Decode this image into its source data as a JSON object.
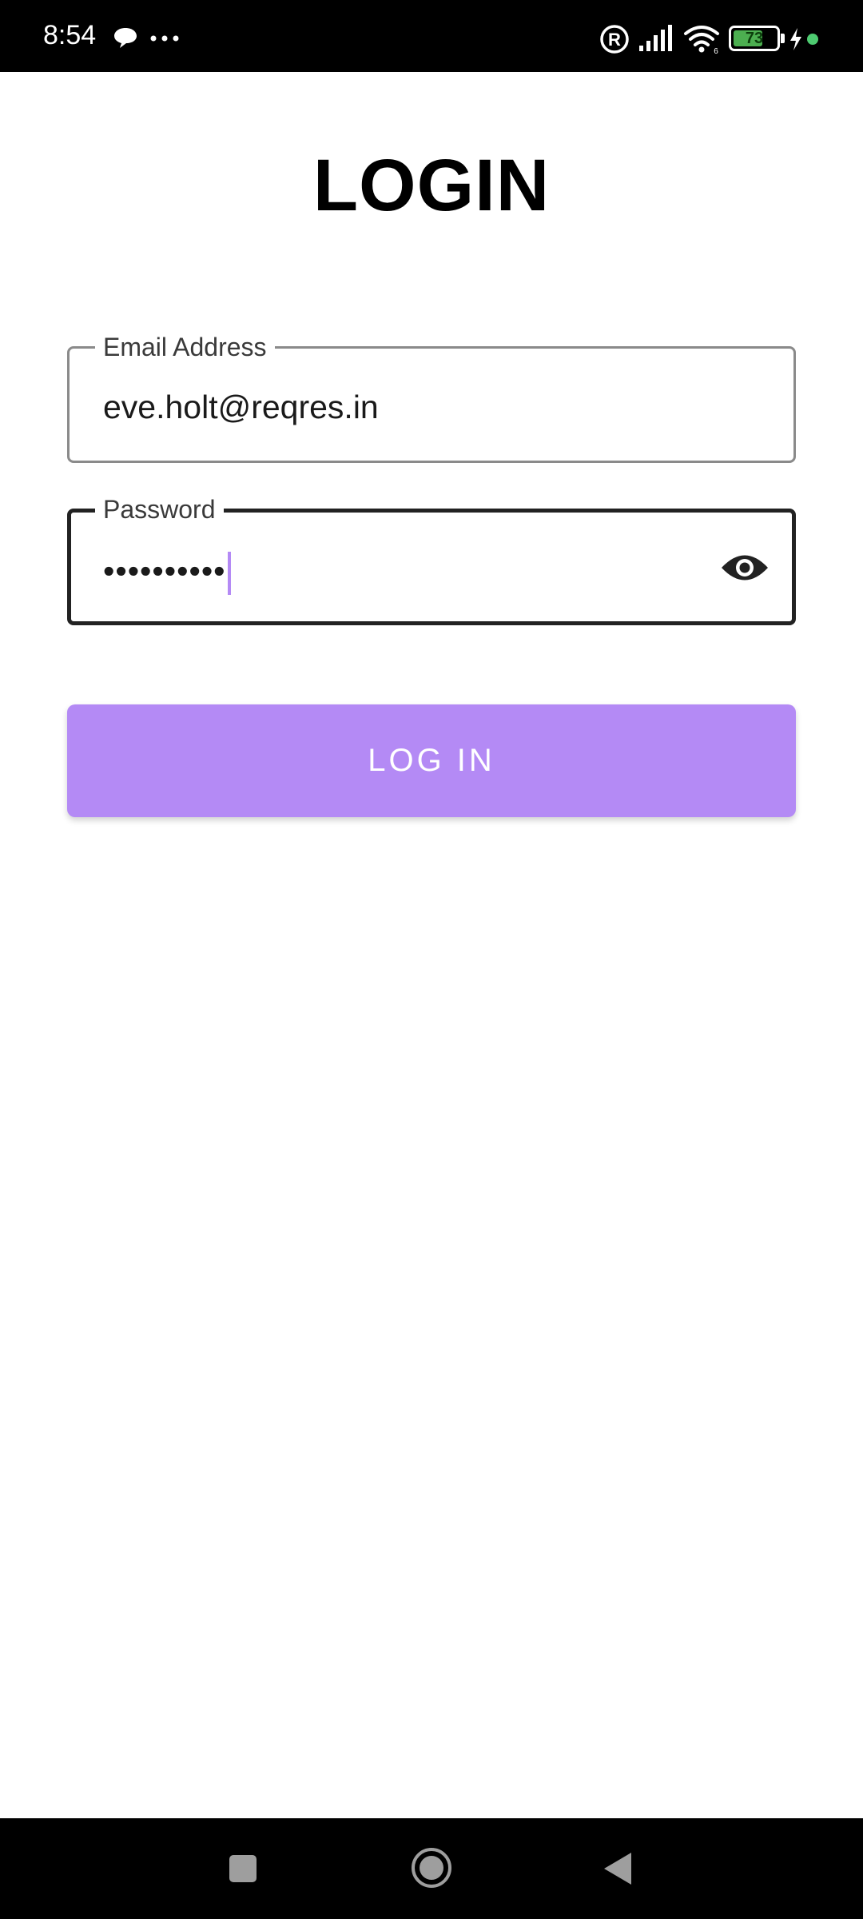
{
  "status_bar": {
    "time": "8:54",
    "battery_level": "73",
    "icons": [
      "message-icon",
      "more-dots-icon",
      "registered-icon",
      "signal-icon",
      "wifi-icon",
      "battery-icon",
      "charging-bolt-icon",
      "status-dot-icon"
    ],
    "battery_color": "#4caf50",
    "dot_color": "#4ecb71"
  },
  "page": {
    "title": "LOGIN"
  },
  "email_field": {
    "label": "Email Address",
    "value": "eve.holt@reqres.in"
  },
  "password_field": {
    "label": "Password",
    "value": "••••••••••",
    "toggle_icon": "eye-icon"
  },
  "login_button": {
    "label": "LOG IN",
    "color": "#b48af5"
  },
  "nav_bar": {
    "icons": [
      "recents-square-icon",
      "home-circle-icon",
      "back-triangle-icon"
    ]
  }
}
